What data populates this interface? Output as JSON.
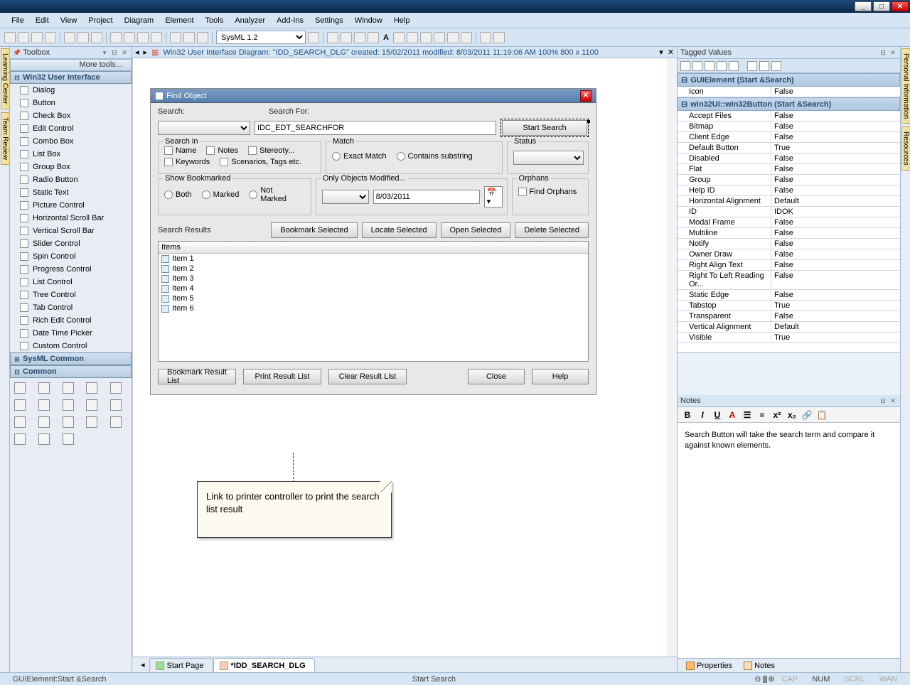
{
  "menubar": [
    "File",
    "Edit",
    "View",
    "Project",
    "Diagram",
    "Element",
    "Tools",
    "Analyzer",
    "Add-Ins",
    "Settings",
    "Window",
    "Help"
  ],
  "toolbar": {
    "combo_value": "SysML 1.2"
  },
  "left_rail": [
    "Learning Center",
    "Team Review"
  ],
  "right_rail": [
    "Personal Information",
    "Resources"
  ],
  "toolbox": {
    "title": "Toolbox",
    "more": "More tools...",
    "section_win32": "Win32 User Interface",
    "win32_items": [
      "Dialog",
      "Button",
      "Check Box",
      "Edit Control",
      "Combo Box",
      "List Box",
      "Group Box",
      "Radio Button",
      "Static Text",
      "Picture Control",
      "Horizontal Scroll Bar",
      "Vertical Scroll Bar",
      "Slider Control",
      "Spin Control",
      "Progress Control",
      "List Control",
      "Tree Control",
      "Tab Control",
      "Rich Edit Control",
      "Date Time Picker",
      "Custom Control"
    ],
    "section_sysml": "SysML Common",
    "section_common": "Common"
  },
  "canvas": {
    "tab_info": "Win32 User Interface Diagram: \"IDD_SEARCH_DLG\"   created: 15/02/2011  modified: 8/03/2011 11:19:06 AM   100%    800 x 1100",
    "dialog_title": "Find Object",
    "search_lbl": "Search:",
    "searchfor_lbl": "Search For:",
    "searchfor_val": "IDC_EDT_SEARCHFOR",
    "start_search": "Start Search",
    "grp_searchin": "Search in",
    "chk_name": "Name",
    "chk_notes": "Notes",
    "chk_stereo": "Stereoty...",
    "chk_keywords": "Keywords",
    "chk_scen": "Scenarios, Tags etc.",
    "grp_match": "Match",
    "rdo_exact": "Exact Match",
    "rdo_contains": "Contains substring",
    "grp_status": "Status",
    "grp_bookmarked": "Show Bookmarked",
    "rdo_both": "Both",
    "rdo_marked": "Marked",
    "rdo_notmarked": "Not Marked",
    "grp_modified": "Only Objects Modified...",
    "date_val": "8/03/2011",
    "grp_orphans": "Orphans",
    "chk_findorphans": "Find Orphans",
    "btn_bookmark_sel": "Bookmark Selected",
    "btn_locate_sel": "Locate Selected",
    "btn_open_sel": "Open Selected",
    "btn_delete_sel": "Delete Selected",
    "search_results": "Search Results",
    "items_hdr": "Items",
    "items": [
      "Item 1",
      "Item 2",
      "Item 3",
      "Item 4",
      "Item 5",
      "Item 6"
    ],
    "btn_bookmark_list": "Bookmark Result List",
    "btn_print_list": "Print Result List",
    "btn_clear_list": "Clear Result List",
    "btn_close": "Close",
    "btn_help": "Help",
    "note": "Link to printer controller to print the search list result",
    "tabs": {
      "start": "Start Page",
      "doc": "*IDD_SEARCH_DLG"
    }
  },
  "tagged": {
    "title": "Tagged Values",
    "cat1": "GUIElement (Start &Search)",
    "icon_row": {
      "k": "Icon",
      "v": "False"
    },
    "cat2": "win32UI::win32Button (Start &Search)",
    "rows": [
      {
        "k": "Accept Files",
        "v": "False"
      },
      {
        "k": "Bitmap",
        "v": "False"
      },
      {
        "k": "Client Edge",
        "v": "False"
      },
      {
        "k": "Default Button",
        "v": "True"
      },
      {
        "k": "Disabled",
        "v": "False"
      },
      {
        "k": "Flat",
        "v": "False"
      },
      {
        "k": "Group",
        "v": "False"
      },
      {
        "k": "Help ID",
        "v": "False"
      },
      {
        "k": "Horizontal Alignment",
        "v": "Default"
      },
      {
        "k": "ID",
        "v": "IDOK"
      },
      {
        "k": "Modal Frame",
        "v": "False"
      },
      {
        "k": "Multiline",
        "v": "False"
      },
      {
        "k": "Notify",
        "v": "False"
      },
      {
        "k": "Owner Draw",
        "v": "False"
      },
      {
        "k": "Right Align Text",
        "v": "False"
      },
      {
        "k": "Right To Left Reading Or...",
        "v": "False"
      },
      {
        "k": "Static Edge",
        "v": "False"
      },
      {
        "k": "Tabstop",
        "v": "True"
      },
      {
        "k": "Transparent",
        "v": "False"
      },
      {
        "k": "Vertical Alignment",
        "v": "Default"
      },
      {
        "k": "Visible",
        "v": "True"
      }
    ]
  },
  "notes": {
    "title": "Notes",
    "body": "Search Button will take the search term and compare it against known elements.",
    "tab_props": "Properties",
    "tab_notes": "Notes"
  },
  "status": {
    "left": "GUIElement:Start &Search",
    "center": "Start Search",
    "cap": "CAP",
    "num": "NUM",
    "scrl": "SCRL",
    "wan": "WAN"
  }
}
